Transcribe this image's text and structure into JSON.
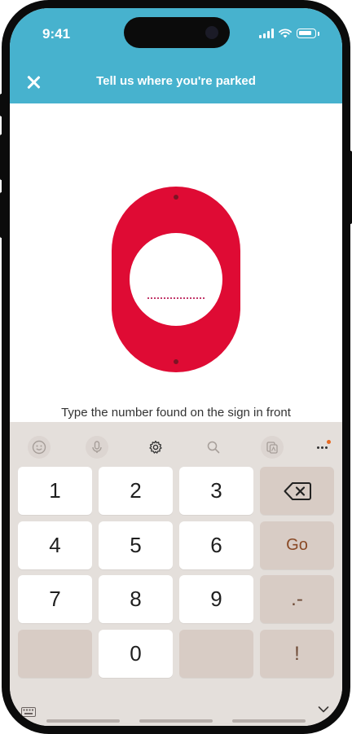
{
  "status_bar": {
    "time": "9:41"
  },
  "nav": {
    "title": "Tell us where you're parked",
    "close_icon": "close-icon"
  },
  "sign": {
    "color": "#df0b34",
    "input_placeholder": ""
  },
  "instruction": "Type the number found on the sign in front",
  "keyboard": {
    "toolbar_icons": [
      "emoji-icon",
      "microphone-icon",
      "gear-icon",
      "search-icon",
      "clipboard-icon",
      "more-icon"
    ],
    "keys": {
      "k1": "1",
      "k2": "2",
      "k3": "3",
      "k4": "4",
      "k5": "5",
      "k6": "6",
      "k7": "7",
      "k8": "8",
      "k9": "9",
      "k0": "0",
      "go": "Go",
      "punct": ".-",
      "bang": "!"
    }
  },
  "colors": {
    "header": "#47b2ce",
    "accent_red": "#df0b34",
    "keyboard_bg": "#e4dfdb"
  }
}
